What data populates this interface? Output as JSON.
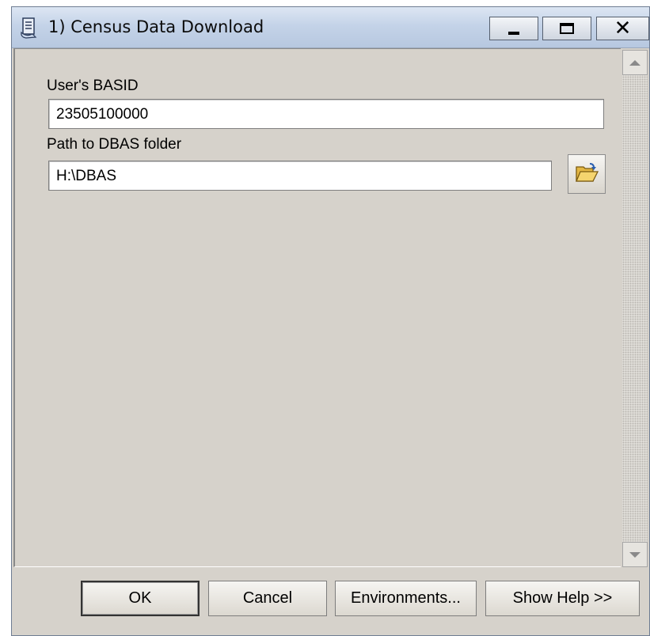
{
  "window": {
    "title": "1) Census Data Download"
  },
  "form": {
    "basid_label": "User's BASID",
    "basid_value": "23505100000",
    "path_label": "Path to DBAS folder",
    "path_value": "H:\\DBAS"
  },
  "buttons": {
    "ok": "OK",
    "cancel": "Cancel",
    "environments": "Environments...",
    "show_help": "Show Help >>"
  },
  "icons": {
    "title": "script-tool-icon",
    "browse": "open-folder-icon",
    "minimize": "minimize-icon",
    "maximize": "maximize-icon",
    "close": "close-icon"
  }
}
